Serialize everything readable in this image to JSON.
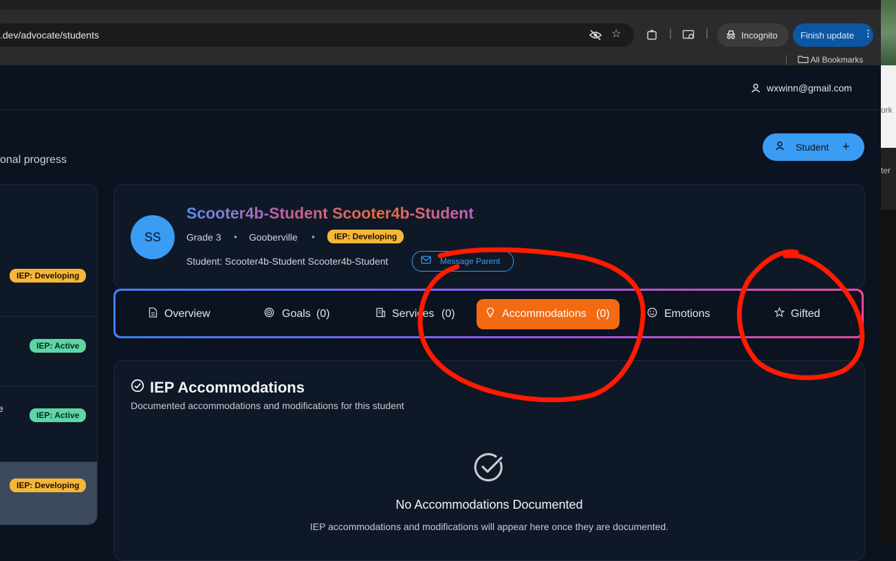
{
  "browser": {
    "url": ".dev/advocate/students",
    "incognito_label": "Incognito",
    "finish_update_label": "Finish update",
    "bookmarks_label": "All Bookmarks"
  },
  "side_peek": {
    "text_1": "ork",
    "text_2": "ter"
  },
  "header": {
    "user_email": "wxwinn@gmail.com"
  },
  "page": {
    "subtitle": "onal progress",
    "add_student_label": "Student"
  },
  "student_list": [
    {
      "badge": "IEP: Developing",
      "status": "developing",
      "text": ""
    },
    {
      "badge": "IEP: Active",
      "status": "active",
      "text": ""
    },
    {
      "badge": "IEP: Active",
      "status": "active",
      "text": "e"
    },
    {
      "badge": "IEP: Developing",
      "status": "developing",
      "text": ""
    }
  ],
  "student": {
    "initials": "SS",
    "name": "Scooter4b-Student Scooter4b-Student",
    "grade": "Grade 3",
    "school": "Gooberville",
    "iep_badge": "IEP: Developing",
    "student_line": "Student: Scooter4b-Student Scooter4b-Student",
    "message_parent_label": "Message Parent"
  },
  "tabs": [
    {
      "label": "Overview",
      "icon": "document-icon",
      "count": ""
    },
    {
      "label": "Goals",
      "icon": "target-icon",
      "count": "(0)"
    },
    {
      "label": "Services",
      "icon": "building-icon",
      "count": "(0)"
    },
    {
      "label": "Accommodations",
      "icon": "lightbulb-icon",
      "count": "(0)",
      "active": true
    },
    {
      "label": "Emotions",
      "icon": "smile-icon",
      "count": ""
    },
    {
      "label": "Gifted",
      "icon": "star-icon",
      "count": ""
    }
  ],
  "accommodations": {
    "title": "IEP Accommodations",
    "subtitle": "Documented accommodations and modifications for this student",
    "empty_title": "No Accommodations Documented",
    "empty_text": "IEP accommodations and modifications will appear here once they are documented."
  },
  "colors": {
    "accent_blue": "#3b9cf3",
    "active_tab": "#f26b12",
    "badge_developing": "#f6b638",
    "badge_active": "#5fd5a6",
    "annotation_red": "#ff1a00"
  }
}
